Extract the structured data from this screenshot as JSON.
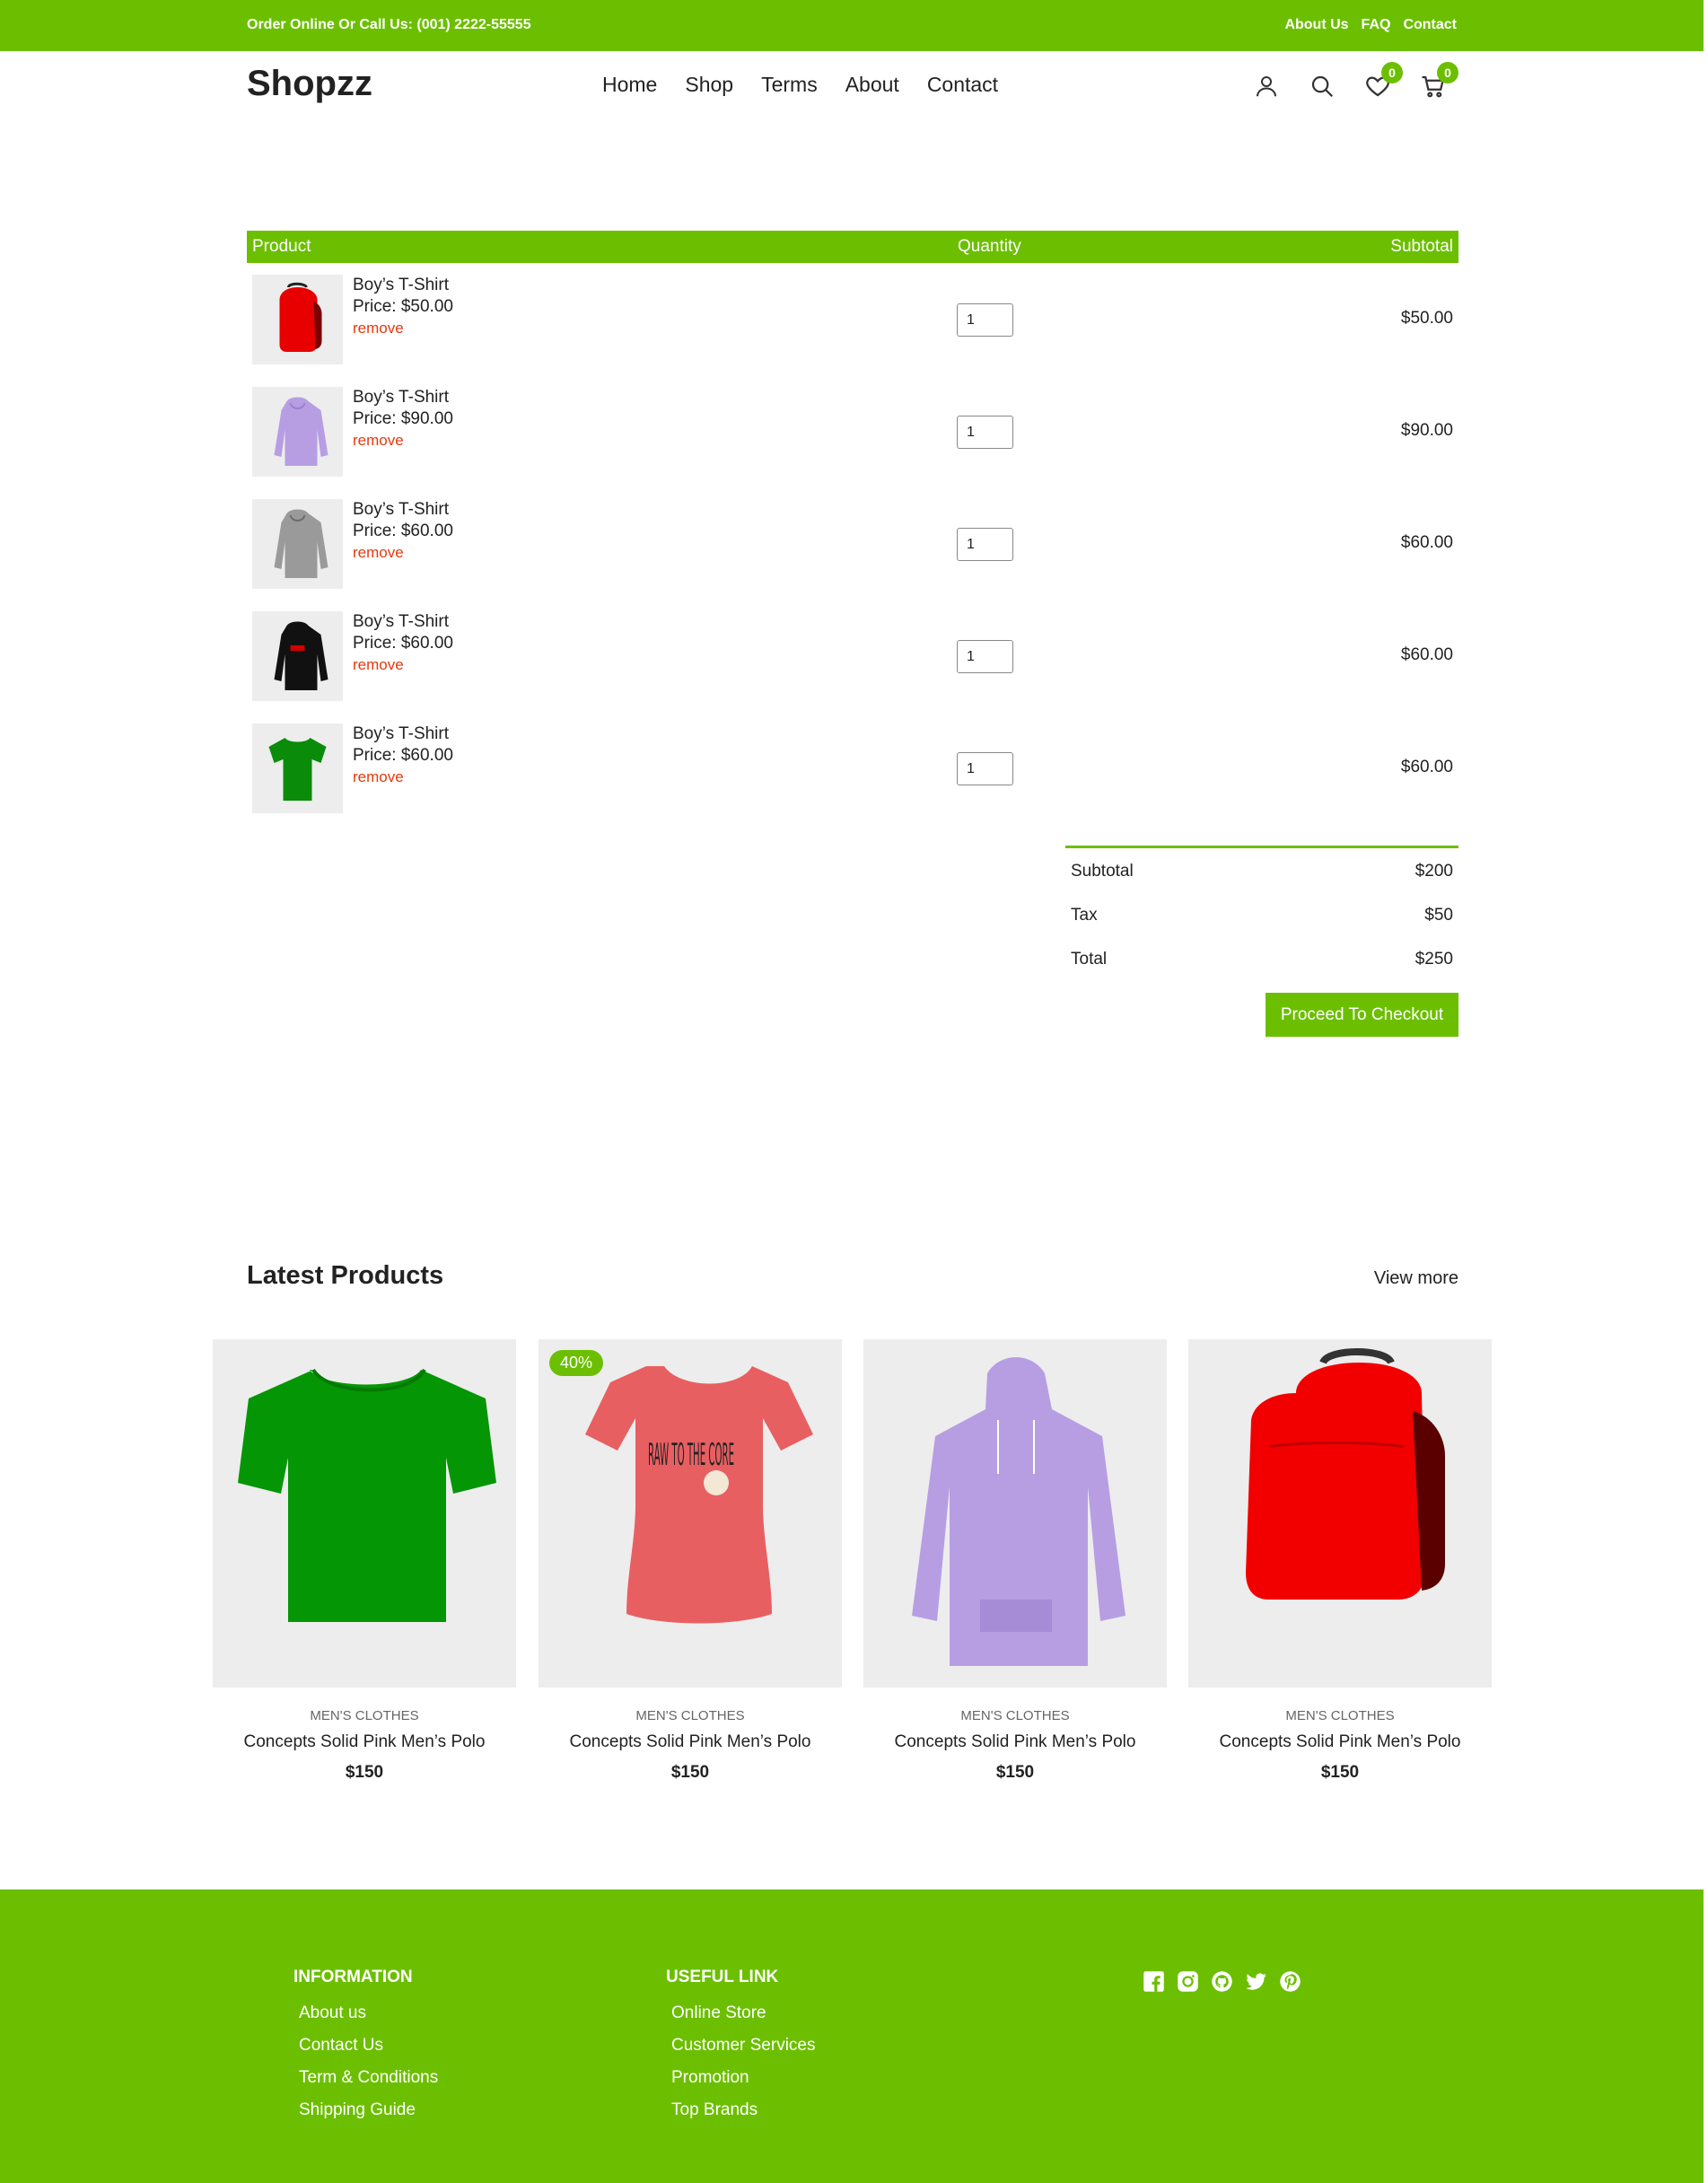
{
  "topbar": {
    "order_text": "Order Online Or Call Us: (001) 2222-55555",
    "links": [
      "About Us",
      "FAQ",
      "Contact"
    ]
  },
  "header": {
    "logo": "Shopzz",
    "nav": [
      "Home",
      "Shop",
      "Terms",
      "About",
      "Contact"
    ],
    "wishlist_count": "0",
    "cart_count": "0",
    "icons": [
      "user-icon",
      "search-icon",
      "heart-icon",
      "cart-icon"
    ]
  },
  "cart": {
    "headers": {
      "product": "Product",
      "quantity": "Quantity",
      "subtotal": "Subtotal"
    },
    "items": [
      {
        "name": "Boy’s T-Shirt",
        "price": "Price: $50.00",
        "remove": "remove",
        "qty": "1",
        "subtotal": "$50.00",
        "image": "red-backpack"
      },
      {
        "name": "Boy’s T-Shirt",
        "price": "Price: $90.00",
        "remove": "remove",
        "qty": "1",
        "subtotal": "$90.00",
        "image": "purple-hoodie"
      },
      {
        "name": "Boy’s T-Shirt",
        "price": "Price: $60.00",
        "remove": "remove",
        "qty": "1",
        "subtotal": "$60.00",
        "image": "gray-hoodie"
      },
      {
        "name": "Boy’s T-Shirt",
        "price": "Price: $60.00",
        "remove": "remove",
        "qty": "1",
        "subtotal": "$60.00",
        "image": "black-hoodie"
      },
      {
        "name": "Boy’s T-Shirt",
        "price": "Price: $60.00",
        "remove": "remove",
        "qty": "1",
        "subtotal": "$60.00",
        "image": "green-tshirt"
      }
    ]
  },
  "summary": {
    "subtotal_label": "Subtotal",
    "subtotal_value": "$200",
    "tax_label": "Tax",
    "tax_value": "$50",
    "total_label": "Total",
    "total_value": "$250",
    "checkout_label": "Proceed To Checkout"
  },
  "latest": {
    "title": "Latest Products",
    "view_more": "View more",
    "products": [
      {
        "category": "MEN'S CLOTHES",
        "name": "Concepts Solid Pink Men’s Polo",
        "price": "$150",
        "tag": "",
        "image": "green-tshirt"
      },
      {
        "category": "MEN'S CLOTHES",
        "name": "Concepts Solid Pink Men’s Polo",
        "price": "$150",
        "tag": "40%",
        "image": "pink-tshirt-raw-to-the-core"
      },
      {
        "category": "MEN'S CLOTHES",
        "name": "Concepts Solid Pink Men’s Polo",
        "price": "$150",
        "tag": "",
        "image": "purple-hoodie"
      },
      {
        "category": "MEN'S CLOTHES",
        "name": "Concepts Solid Pink Men’s Polo",
        "price": "$150",
        "tag": "",
        "image": "red-backpack"
      }
    ],
    "graphic_text": "RAW TO THE CORE"
  },
  "footer": {
    "info_title": "INFORMATION",
    "info_links": [
      "About us",
      "Contact Us",
      "Term & Conditions",
      "Shipping Guide"
    ],
    "useful_title": "USEFUL LINK",
    "useful_links": [
      "Online Store",
      "Customer Services",
      "Promotion",
      "Top Brands"
    ],
    "socials": [
      "facebook-icon",
      "instagram-icon",
      "github-icon",
      "twitter-icon",
      "pinterest-icon"
    ]
  },
  "colors": {
    "brand": "#6cbf00",
    "remove": "#e8380d",
    "thumb_bg": "#ededed"
  }
}
